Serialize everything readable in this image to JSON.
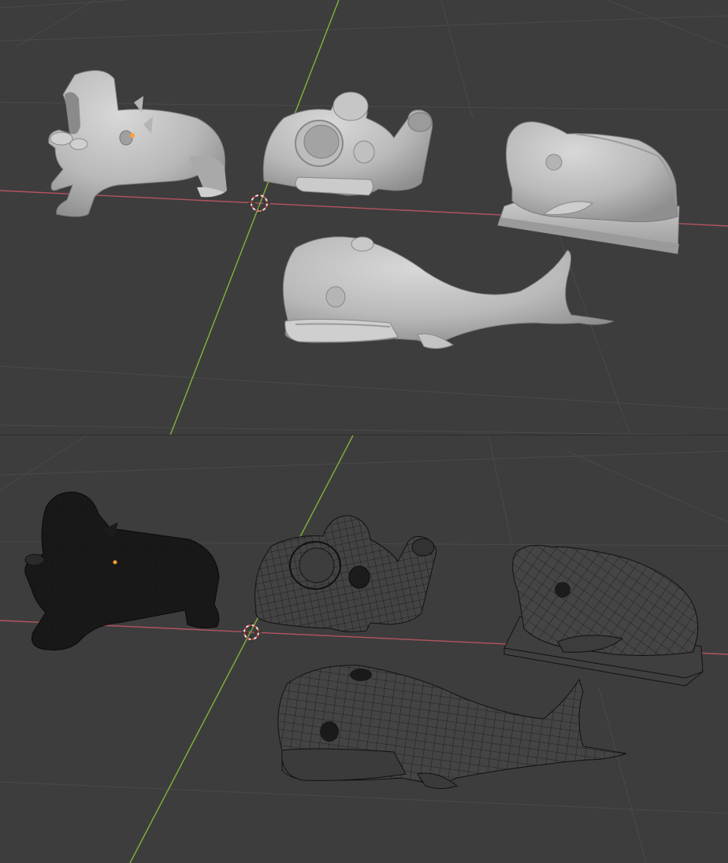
{
  "colors": {
    "background": "#3d3d3d",
    "grid_line": "#4a4a4a",
    "x_axis": "#b4545f",
    "y_axis": "#7fb33a",
    "solid_base": "#bdbdbd",
    "solid_shadow": "#8e8e8e",
    "solid_highlight": "#d6d6d6",
    "wire_fill": "#454545",
    "wire_line": "#101010",
    "origin_dot": "#ffa033",
    "cursor": "#e8e8e8",
    "cursor_accent": "#d0403a"
  },
  "icons": {
    "cursor": "3d-cursor-icon",
    "origin": "object-origin-icon"
  },
  "viewports": [
    {
      "name": "solid-viewport",
      "shading": "solid",
      "objects": [
        "hippo",
        "koala",
        "fish",
        "whale"
      ]
    },
    {
      "name": "wireframe-viewport",
      "shading": "wireframe",
      "objects": [
        "hippo",
        "koala",
        "fish",
        "whale"
      ]
    }
  ]
}
